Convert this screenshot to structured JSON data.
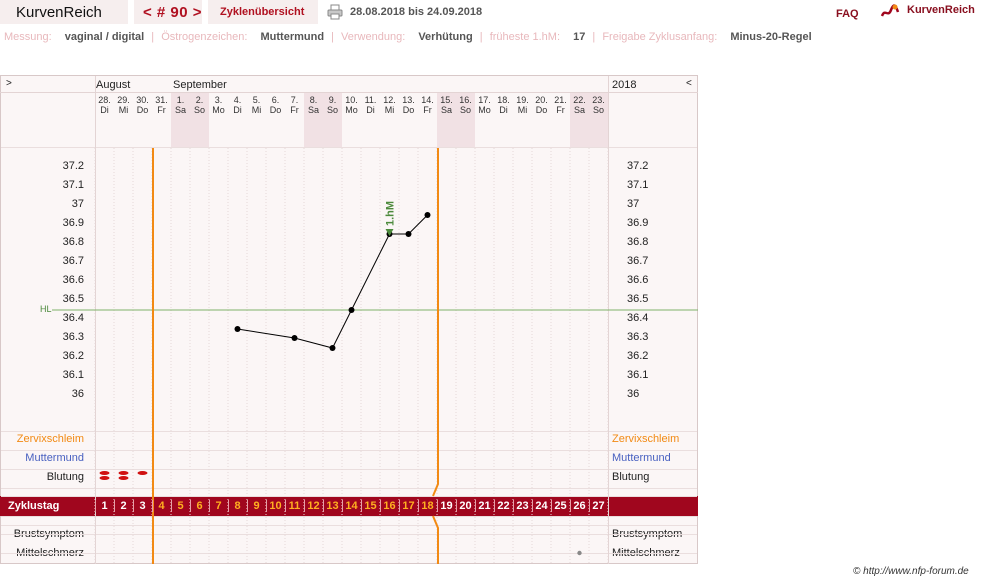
{
  "header": {
    "app_name": "KurvenReich",
    "cycle_label": "< # 90 >",
    "overview_label": "Zyklenübersicht",
    "date_range": "28.08.2018 bis 24.09.2018",
    "faq_label": "FAQ",
    "brand_label": "KurvenReich"
  },
  "info": {
    "measure_label": "Messung:",
    "measure_value": "vaginal / digital",
    "estrogen_label": "Östrogenzeichen:",
    "estrogen_value": "Muttermund",
    "usage_label": "Verwendung:",
    "usage_value": "Verhütung",
    "earliest_label": "früheste 1.hM:",
    "earliest_value": "17",
    "release_label": "Freigabe Zyklusanfang:",
    "release_value": "Minus-20-Regel"
  },
  "chart": {
    "nav_prev": ">",
    "nav_next": "<",
    "year": "2018",
    "month_august": "August",
    "month_september": "September",
    "days": [
      {
        "d": "28.",
        "w": "Di"
      },
      {
        "d": "29.",
        "w": "Mi"
      },
      {
        "d": "30.",
        "w": "Do"
      },
      {
        "d": "31.",
        "w": "Fr"
      },
      {
        "d": "1.",
        "w": "Sa"
      },
      {
        "d": "2.",
        "w": "So"
      },
      {
        "d": "3.",
        "w": "Mo"
      },
      {
        "d": "4.",
        "w": "Di"
      },
      {
        "d": "5.",
        "w": "Mi"
      },
      {
        "d": "6.",
        "w": "Do"
      },
      {
        "d": "7.",
        "w": "Fr"
      },
      {
        "d": "8.",
        "w": "Sa"
      },
      {
        "d": "9.",
        "w": "So"
      },
      {
        "d": "10.",
        "w": "Mo"
      },
      {
        "d": "11.",
        "w": "Di"
      },
      {
        "d": "12.",
        "w": "Mi"
      },
      {
        "d": "13.",
        "w": "Do"
      },
      {
        "d": "14.",
        "w": "Fr"
      },
      {
        "d": "15.",
        "w": "Sa"
      },
      {
        "d": "16.",
        "w": "So"
      },
      {
        "d": "17.",
        "w": "Mo"
      },
      {
        "d": "18.",
        "w": "Di"
      },
      {
        "d": "19.",
        "w": "Mi"
      },
      {
        "d": "20.",
        "w": "Do"
      },
      {
        "d": "21.",
        "w": "Fr"
      },
      {
        "d": "22.",
        "w": "Sa"
      },
      {
        "d": "23.",
        "w": "So"
      }
    ],
    "rows": {
      "zervix": "Zervixschleim",
      "muttermund": "Muttermund",
      "blutung": "Blutung",
      "zyklustag": "Zyklustag",
      "brust": "Brustsymptom",
      "mittel": "Mittelschmerz"
    },
    "hl_label": "HL",
    "marker_label": "1.hM",
    "colors": {
      "accent": "#a0061e",
      "temp_line": "#000000",
      "hl_line": "#7fb26a",
      "phase_line": "#f28a14",
      "marker": "#4c8a3c"
    }
  },
  "chart_data": {
    "type": "line",
    "ylim": [
      36.0,
      37.2
    ],
    "y_ticks": [
      "37.2",
      "37.1",
      "37",
      "36.9",
      "36.8",
      "36.7",
      "36.6",
      "36.5",
      "36.4",
      "36.3",
      "36.2",
      "36.1",
      "36"
    ],
    "cycle_days": [
      1,
      2,
      3,
      4,
      5,
      6,
      7,
      8,
      9,
      10,
      11,
      12,
      13,
      14,
      15,
      16,
      17,
      18,
      19,
      20,
      21,
      22,
      23,
      24,
      25,
      26,
      27
    ],
    "series": [
      {
        "points": [
          [
            8,
            36.35
          ],
          [
            11,
            36.3
          ],
          [
            13,
            36.25
          ],
          [
            14,
            36.45
          ],
          [
            16,
            36.85
          ],
          [
            17,
            36.85
          ],
          [
            18,
            36.95
          ]
        ]
      }
    ],
    "hl_value": 36.45,
    "first_high_day": 16,
    "phase_lines_after_day": [
      3,
      18
    ],
    "bleeding_days": [
      1,
      2,
      3
    ],
    "mittelschmerz_days": [
      26
    ],
    "weekend_indices": [
      4,
      5,
      11,
      12,
      18,
      19,
      25,
      26
    ]
  },
  "footer": {
    "copyright": "© http://www.nfp-forum.de"
  }
}
